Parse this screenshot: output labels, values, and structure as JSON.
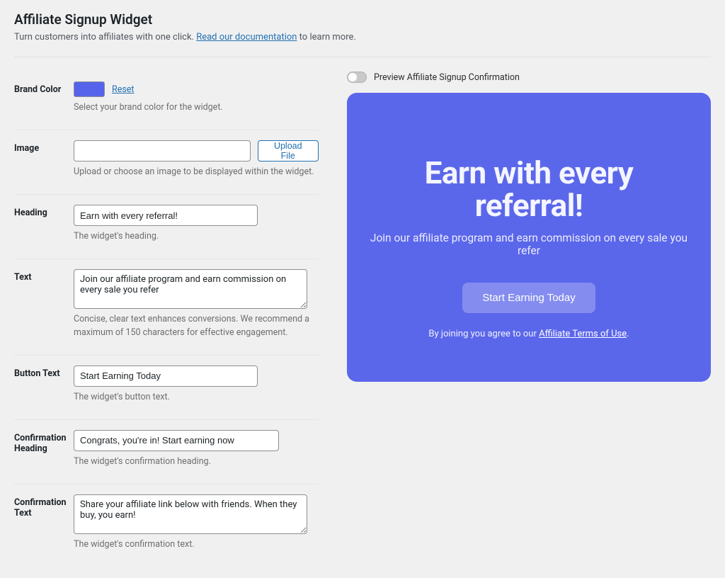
{
  "page": {
    "title": "Affiliate Signup Widget",
    "subtitle_before": "Turn customers into affiliates with one click. ",
    "subtitle_link": "Read our documentation",
    "subtitle_after": " to learn more."
  },
  "form": {
    "brand_color": {
      "label": "Brand Color",
      "value": "#5663eb",
      "reset": "Reset",
      "hint": "Select your brand color for the widget."
    },
    "image": {
      "label": "Image",
      "value": "",
      "button": "Upload File",
      "hint": "Upload or choose an image to be displayed within the widget."
    },
    "heading": {
      "label": "Heading",
      "value": "Earn with every referral!",
      "hint": "The widget's heading."
    },
    "text": {
      "label": "Text",
      "value": "Join our affiliate program and earn commission on every sale you refer",
      "hint": "Concise, clear text enhances conversions. We recommend a maximum of 150 characters for effective engagement."
    },
    "button_text": {
      "label": "Button Text",
      "value": "Start Earning Today",
      "hint": "The widget's button text."
    },
    "confirm_heading": {
      "label": "Confirmation Heading",
      "value": "Congrats, you're in! Start earning now",
      "hint": "The widget's confirmation heading."
    },
    "confirm_text": {
      "label": "Confirmation Text",
      "value": "Share your affiliate link below with friends. When they buy, you earn!",
      "hint": "The widget's confirmation text."
    }
  },
  "preview": {
    "toggle_label": "Preview Affiliate Signup Confirmation",
    "heading": "Earn with every referral!",
    "text": "Join our affiliate program and earn commission on every sale you refer",
    "button": "Start Earning Today",
    "footer_before": "By joining you agree to our ",
    "footer_link": "Affiliate Terms of Use",
    "footer_after": ".",
    "bg_color": "#5b67ea"
  }
}
